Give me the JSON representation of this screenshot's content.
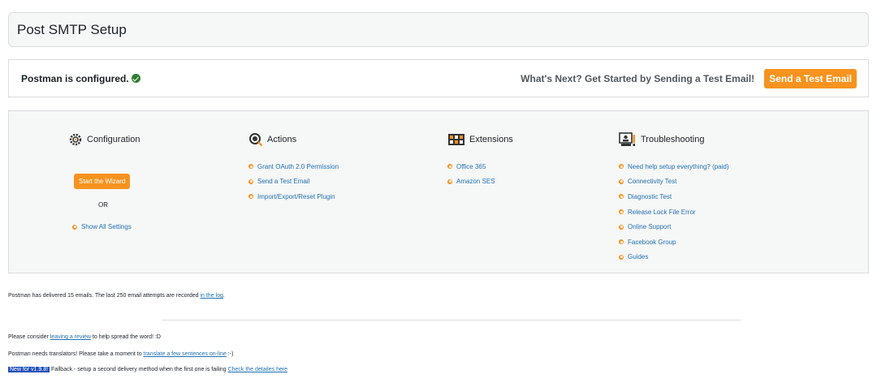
{
  "header": {
    "title": "Post SMTP Setup"
  },
  "status": {
    "configured_text": "Postman is configured.",
    "next_text": "What's Next? Get Started by Sending a Test Email!",
    "send_button": "Send a Test Email"
  },
  "panel": {
    "configuration": {
      "title": "Configuration",
      "wizard_button": "Start the Wizard",
      "or_text": "OR",
      "show_all": "Show All Settings"
    },
    "actions": {
      "title": "Actions",
      "items": [
        "Grant OAuth 2.0 Permission",
        "Send a Test Email",
        "Import/Export/Reset Plugin"
      ]
    },
    "extensions": {
      "title": "Extensions",
      "items": [
        "Office 365",
        "Amazon SES"
      ]
    },
    "troubleshooting": {
      "title": "Troubleshooting",
      "items": [
        "Need help setup everything? (paid)",
        "Connectivity Test",
        "Diagnostic Test",
        "Release Lock File Error",
        "Online Support",
        "Facebook Group",
        "Guides"
      ]
    }
  },
  "footer": {
    "delivered_pre": "Postman has delivered 15 emails. The last 250 email attempts are recorded ",
    "delivered_link": "in the log",
    "delivered_post": ".",
    "review_pre": "Please consider ",
    "review_link": "leaving a review",
    "review_post": " to help spread the word! :D",
    "translate_pre": "Postman needs translators! Please take a moment to ",
    "translate_link": "translate a few sentences on-line",
    "translate_post": " :-)",
    "new_badge": "New for v1.9.8!",
    "new_text": " Fallback - setup a second delivery method when the first one is failing ",
    "new_link": "Check the detailes here"
  },
  "colors": {
    "accent": "#f7931e",
    "link": "#2271b1",
    "badge": "#1e50b8",
    "check": "#2e7d32"
  }
}
